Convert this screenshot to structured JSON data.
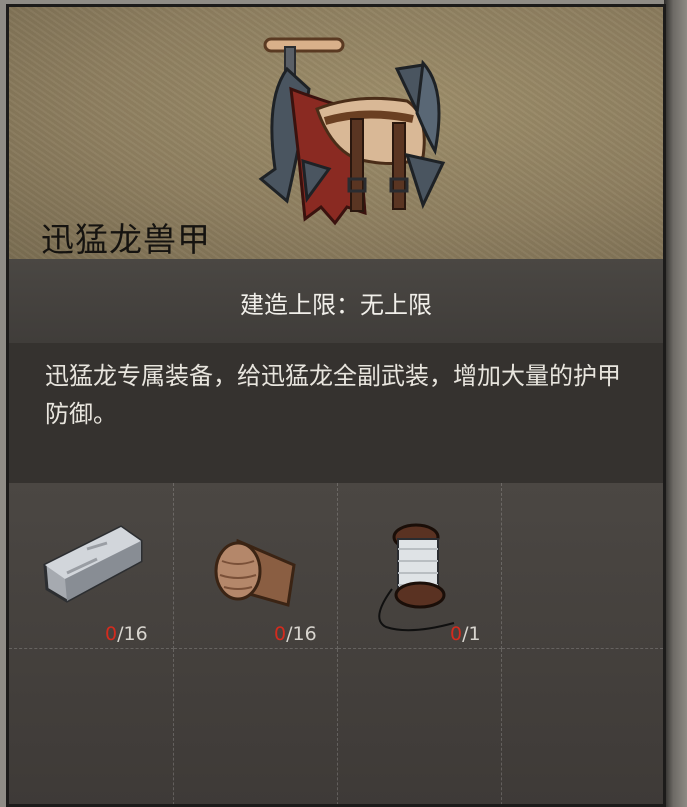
{
  "item": {
    "name": "迅猛龙兽甲",
    "icon": "raptor-saddle-icon"
  },
  "build_limit": "建造上限：无上限",
  "description": "迅猛龙专属装备，给迅猛龙全副武装，增加大量的护甲防御。",
  "materials": [
    {
      "icon": "metal-ingot-icon",
      "have": "0",
      "need": "/16"
    },
    {
      "icon": "leather-roll-icon",
      "have": "0",
      "need": "/16"
    },
    {
      "icon": "thread-spool-icon",
      "have": "0",
      "need": "/1"
    }
  ],
  "colors": {
    "header_bg": "#8e7f60",
    "count_have": "#d32b1e",
    "count_need": "#d8d5cf"
  }
}
